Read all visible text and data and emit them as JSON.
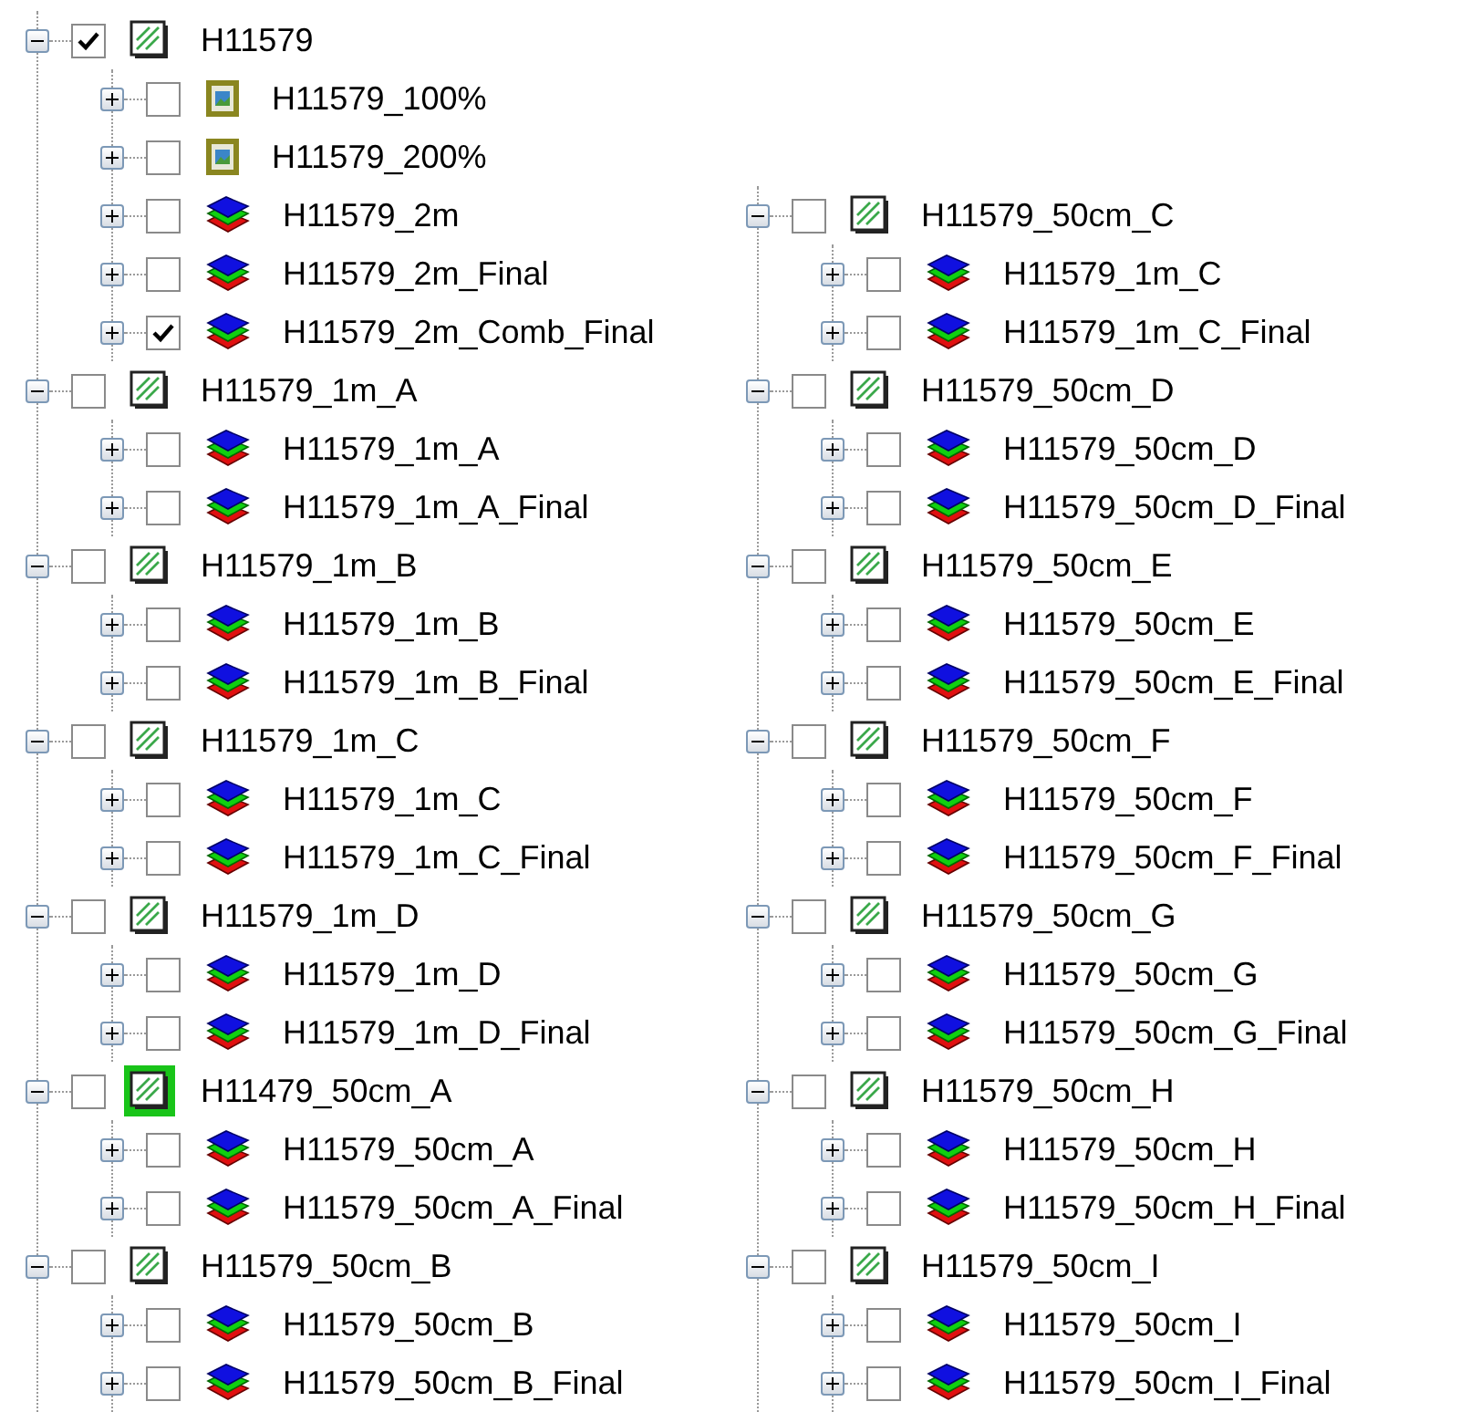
{
  "columns": [
    {
      "nodes": [
        {
          "label": "H11579",
          "kind": "group",
          "checked": true,
          "expanded": true,
          "selected": false,
          "children": [
            {
              "label": "H11579_100%",
              "kind": "image",
              "checked": false,
              "expanded": false
            },
            {
              "label": "H11579_200%",
              "kind": "image",
              "checked": false,
              "expanded": false
            },
            {
              "label": "H11579_2m",
              "kind": "raster",
              "checked": false,
              "expanded": false
            },
            {
              "label": "H11579_2m_Final",
              "kind": "raster",
              "checked": false,
              "expanded": false
            },
            {
              "label": "H11579_2m_Comb_Final",
              "kind": "raster",
              "checked": true,
              "expanded": false
            }
          ]
        },
        {
          "label": "H11579_1m_A",
          "kind": "group",
          "checked": false,
          "expanded": true,
          "selected": false,
          "children": [
            {
              "label": "H11579_1m_A",
              "kind": "raster",
              "checked": false,
              "expanded": false
            },
            {
              "label": "H11579_1m_A_Final",
              "kind": "raster",
              "checked": false,
              "expanded": false
            }
          ]
        },
        {
          "label": "H11579_1m_B",
          "kind": "group",
          "checked": false,
          "expanded": true,
          "selected": false,
          "children": [
            {
              "label": "H11579_1m_B",
              "kind": "raster",
              "checked": false,
              "expanded": false
            },
            {
              "label": "H11579_1m_B_Final",
              "kind": "raster",
              "checked": false,
              "expanded": false
            }
          ]
        },
        {
          "label": "H11579_1m_C",
          "kind": "group",
          "checked": false,
          "expanded": true,
          "selected": false,
          "children": [
            {
              "label": "H11579_1m_C",
              "kind": "raster",
              "checked": false,
              "expanded": false
            },
            {
              "label": "H11579_1m_C_Final",
              "kind": "raster",
              "checked": false,
              "expanded": false
            }
          ]
        },
        {
          "label": "H11579_1m_D",
          "kind": "group",
          "checked": false,
          "expanded": true,
          "selected": false,
          "children": [
            {
              "label": "H11579_1m_D",
              "kind": "raster",
              "checked": false,
              "expanded": false
            },
            {
              "label": "H11579_1m_D_Final",
              "kind": "raster",
              "checked": false,
              "expanded": false
            }
          ]
        },
        {
          "label": "H11479_50cm_A",
          "kind": "group",
          "checked": false,
          "expanded": true,
          "selected": true,
          "children": [
            {
              "label": "H11579_50cm_A",
              "kind": "raster",
              "checked": false,
              "expanded": false
            },
            {
              "label": "H11579_50cm_A_Final",
              "kind": "raster",
              "checked": false,
              "expanded": false
            }
          ]
        },
        {
          "label": "H11579_50cm_B",
          "kind": "group",
          "checked": false,
          "expanded": true,
          "selected": false,
          "children": [
            {
              "label": "H11579_50cm_B",
              "kind": "raster",
              "checked": false,
              "expanded": false
            },
            {
              "label": "H11579_50cm_B_Final",
              "kind": "raster",
              "checked": false,
              "expanded": false
            }
          ]
        }
      ]
    },
    {
      "nodes": [
        {
          "label": "H11579_50cm_C",
          "kind": "group",
          "checked": false,
          "expanded": true,
          "selected": false,
          "children": [
            {
              "label": "H11579_1m_C",
              "kind": "raster",
              "checked": false,
              "expanded": false
            },
            {
              "label": "H11579_1m_C_Final",
              "kind": "raster",
              "checked": false,
              "expanded": false
            }
          ]
        },
        {
          "label": "H11579_50cm_D",
          "kind": "group",
          "checked": false,
          "expanded": true,
          "selected": false,
          "children": [
            {
              "label": "H11579_50cm_D",
              "kind": "raster",
              "checked": false,
              "expanded": false
            },
            {
              "label": "H11579_50cm_D_Final",
              "kind": "raster",
              "checked": false,
              "expanded": false
            }
          ]
        },
        {
          "label": "H11579_50cm_E",
          "kind": "group",
          "checked": false,
          "expanded": true,
          "selected": false,
          "children": [
            {
              "label": "H11579_50cm_E",
              "kind": "raster",
              "checked": false,
              "expanded": false
            },
            {
              "label": "H11579_50cm_E_Final",
              "kind": "raster",
              "checked": false,
              "expanded": false
            }
          ]
        },
        {
          "label": "H11579_50cm_F",
          "kind": "group",
          "checked": false,
          "expanded": true,
          "selected": false,
          "children": [
            {
              "label": "H11579_50cm_F",
              "kind": "raster",
              "checked": false,
              "expanded": false
            },
            {
              "label": "H11579_50cm_F_Final",
              "kind": "raster",
              "checked": false,
              "expanded": false
            }
          ]
        },
        {
          "label": "H11579_50cm_G",
          "kind": "group",
          "checked": false,
          "expanded": true,
          "selected": false,
          "children": [
            {
              "label": "H11579_50cm_G",
              "kind": "raster",
              "checked": false,
              "expanded": false
            },
            {
              "label": "H11579_50cm_G_Final",
              "kind": "raster",
              "checked": false,
              "expanded": false
            }
          ]
        },
        {
          "label": "H11579_50cm_H",
          "kind": "group",
          "checked": false,
          "expanded": true,
          "selected": false,
          "children": [
            {
              "label": "H11579_50cm_H",
              "kind": "raster",
              "checked": false,
              "expanded": false
            },
            {
              "label": "H11579_50cm_H_Final",
              "kind": "raster",
              "checked": false,
              "expanded": false
            }
          ]
        },
        {
          "label": "H11579_50cm_I",
          "kind": "group",
          "checked": false,
          "expanded": true,
          "selected": false,
          "children": [
            {
              "label": "H11579_50cm_I",
              "kind": "raster",
              "checked": false,
              "expanded": false
            },
            {
              "label": "H11579_50cm_I_Final",
              "kind": "raster",
              "checked": false,
              "expanded": false
            }
          ]
        }
      ]
    }
  ]
}
